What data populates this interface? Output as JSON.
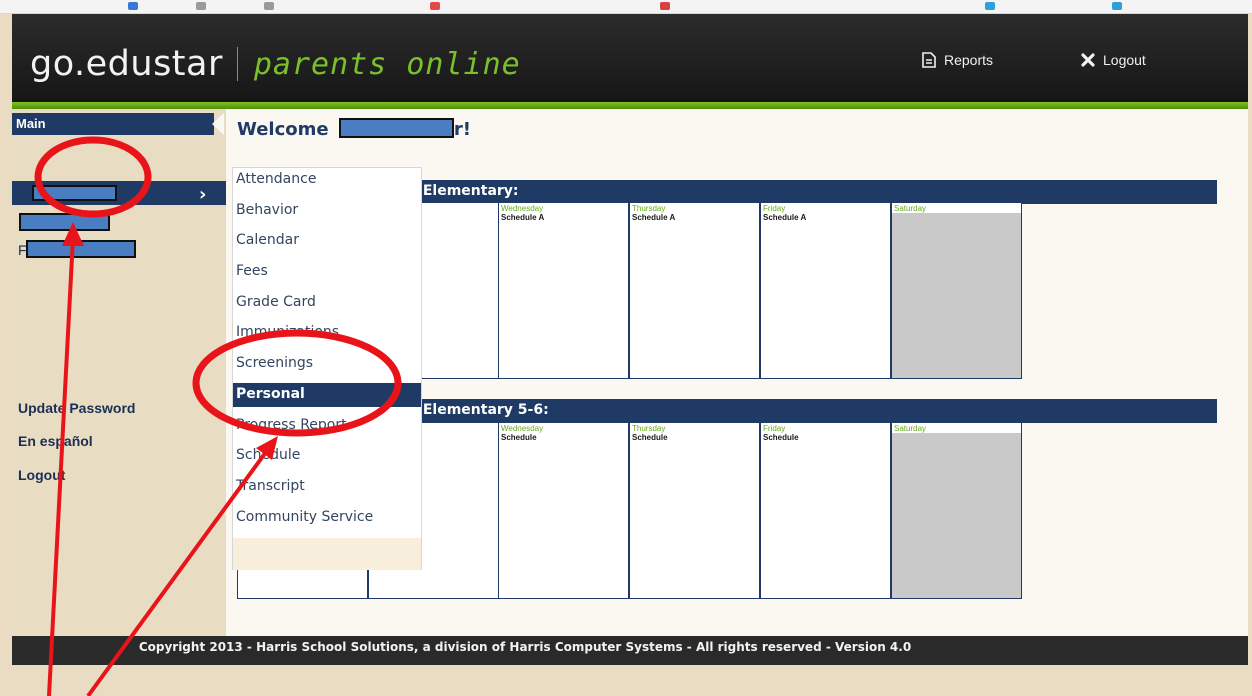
{
  "header": {
    "logo_main": "go.edustar",
    "logo_sub": "parents online",
    "reports_label": "Reports",
    "logout_label": "Logout"
  },
  "sidebar": {
    "main_label": "Main",
    "letter_fragment": "F",
    "links": [
      "Update Password",
      "En español",
      "Logout"
    ]
  },
  "welcome": {
    "prefix": "Welcome",
    "suffix": "r!"
  },
  "calendar": {
    "sections": [
      {
        "title_fragment": "n Elementary:",
        "cut_label": "A",
        "days": [
          {
            "name": "Wednesday",
            "schedule": "Schedule A"
          },
          {
            "name": "Thursday",
            "schedule": "Schedule A"
          },
          {
            "name": "Friday",
            "schedule": "Schedule A"
          },
          {
            "name": "Saturday",
            "schedule": ""
          }
        ]
      },
      {
        "title_fragment": "n Elementary 5-6:",
        "cut_label": "",
        "days": [
          {
            "name": "Wednesday",
            "schedule": "Schedule"
          },
          {
            "name": "Thursday",
            "schedule": "Schedule"
          },
          {
            "name": "Friday",
            "schedule": "Schedule"
          },
          {
            "name": "Saturday",
            "schedule": ""
          }
        ]
      }
    ]
  },
  "dropdown": {
    "items": [
      "Attendance",
      "Behavior",
      "Calendar",
      "Fees",
      "Grade Card",
      "Immunizations",
      "Screenings",
      "Personal",
      "Progress Report",
      "Schedule",
      "Transcript",
      "Community Service"
    ],
    "active": "Personal"
  },
  "footer": {
    "text": "Copyright 2013 - Harris School Solutions, a division of Harris Computer Systems - All rights reserved - Version 4.0"
  },
  "colors": {
    "navy": "#1f3a64",
    "green_accent": "#7ac02a",
    "sidebar_bg": "#e8dcc3",
    "annotation_red": "#e8141a",
    "redaction_blue": "#4a7ec2"
  }
}
